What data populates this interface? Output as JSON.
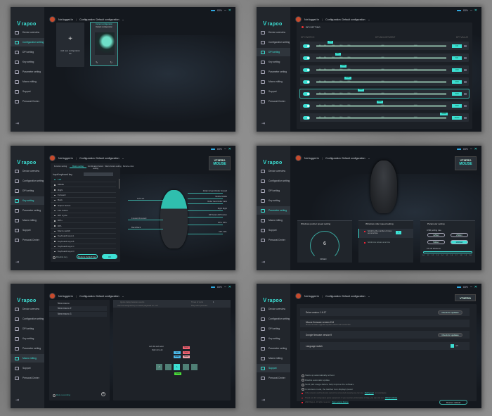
{
  "common": {
    "logo": "rapoo",
    "battery": "83%",
    "login": "Not logged in",
    "configuration": "Configuration: Default configuration",
    "sidebar": [
      "Device overview",
      "Configuration setting",
      "DPI setting",
      "Key setting",
      "Parameter setting",
      "Macro editing",
      "Support",
      "Personal Center"
    ],
    "device_badge": "VT9PRO",
    "device_type": "MOUSE"
  },
  "config_page": {
    "add_label": "Add new configuration file",
    "current_label": "Current configuration",
    "current_name": "Default configuration"
  },
  "dpi_page": {
    "title": "DPI SETTING",
    "col_switch": "DPI SWITCH",
    "col_adjust": "DPI ADJUSTMENT",
    "col_value": "DPI VALUE",
    "max": 26000,
    "rows": [
      {
        "value": "400",
        "selected": false
      },
      {
        "value": "800",
        "selected": false
      },
      {
        "value": "1200",
        "selected": false
      },
      {
        "value": "1600",
        "selected": false
      },
      {
        "value": "3200",
        "selected": true
      },
      {
        "value": "6400",
        "selected": false
      },
      {
        "value": "26000",
        "selected": false
      }
    ],
    "ticks": [
      "400",
      "800",
      "1600",
      "2400",
      "3200",
      "6400",
      "14000"
    ]
  },
  "key_page": {
    "tabs": [
      "Function setting",
      "Button setting",
      "Combination button setting",
      "Macro button setting"
    ],
    "device_color": "Device color",
    "input_label": "Input keyboard key",
    "items": [
      "Left",
      "Middle",
      "Right",
      "Forward",
      "Back",
      "Sniper button",
      "Fire button",
      "DPI Cycle",
      "DPI+",
      "DPI-",
      "Macro switch",
      "Keyboard keys A",
      "Keyboard keys B",
      "Keyboard keys C",
      "Keyboard keys D"
    ],
    "disable": "Disable key",
    "restore": "Restore default key",
    "ok": "OK",
    "left_labels": [
      "Left Left",
      "Forward Forward",
      "Back Back"
    ],
    "right_labels": [
      "Roller forward Roller forward",
      "Middle Middle",
      "Roller back Roller back",
      "Right Right",
      "DPI button DPI button",
      "DPI+ DPI+",
      "DPI- DPI-"
    ]
  },
  "param_page": {
    "pointer_title": "Windows pointer speed setting",
    "speed_value": "6",
    "speed_label": "SPEED",
    "roller_title": "Windows roller speed setting",
    "roller_opt1": "Scroll by the number of rows set at a time",
    "roller_value": "3",
    "roller_opt2": "Scroll one screen at a time",
    "param_title": "Parameter setting",
    "polling_label": "USB polling rate",
    "polling": [
      "125Hz",
      "250Hz",
      "500Hz",
      "1000Hz"
    ],
    "polling_selected": "1000Hz",
    "liftoff_label": "Lift-off Distance",
    "liftoff_ticks": [
      "1.0",
      "1.1",
      "1.2",
      "1.3",
      "1.4",
      "1.5",
      "1.6",
      "1.7",
      "1.8",
      "1.9",
      "2.0"
    ],
    "liftoff_value": 1.0
  },
  "macro_page": {
    "macros": [
      "New macro",
      "New macro 2",
      "New macro 3"
    ],
    "recording": "Role recording",
    "ignore_delay": "Ignore delay between events",
    "assigned_key": "Use the assigned key to switch playback on / off",
    "times": "Times of cycle",
    "times_value": "1",
    "play_pressed": "Play when pressed",
    "hint1": "Left click and select",
    "hint2": "Right click edit",
    "tags": [
      "Add",
      "Modify",
      "Delete",
      "Insert",
      "Delete",
      "Delay"
    ]
  },
  "support_page": {
    "rows": [
      {
        "label": "Drive version: 1.6.17",
        "button": "Check for updates"
      },
      {
        "label": "Mouse firmware version:214",
        "sub": "Mouse firmware upgrade requires wired mode connection"
      },
      {
        "label": "Dongle firmware version:9",
        "button": "Check for updates"
      },
      {
        "label": "Language switch",
        "button": "EN"
      }
    ],
    "options": [
      "Starts up automatically at boot",
      "Disable automatic update",
      "Send part usage data to help improve the software",
      "In wireless mode, the taskbar icon displays power"
    ],
    "notes": [
      {
        "text": "If the receiver and the device cannot be connected properly,you can use",
        "link": "Pairing tool",
        "after": "to reconfigure"
      },
      {
        "text": "Thank you for using rapoo game equipment. If you need any information or help, you can visit our",
        "link": "Official website",
        "after": ""
      },
      {
        "text": "2024 Rapoo. All rights reserved",
        "link": "Open source license",
        "after": ""
      }
    ],
    "restore": "Restore default"
  }
}
